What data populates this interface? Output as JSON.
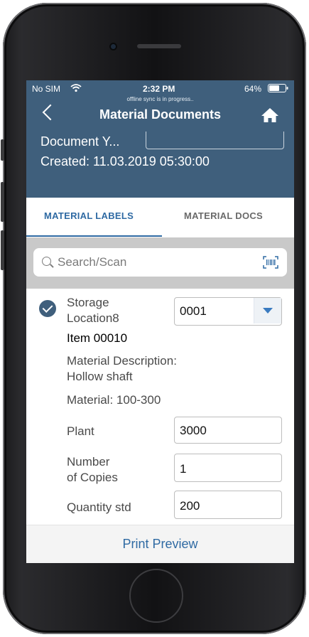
{
  "status_bar": {
    "carrier": "No SIM",
    "time": "2:32 PM",
    "battery": "64%",
    "sync_message": "offline sync is in progress.."
  },
  "header": {
    "title": "Material Documents",
    "document_year_label": "Document Y...",
    "created": "Created: 11.03.2019 05:30:00"
  },
  "tabs": [
    {
      "label": "MATERIAL LABELS",
      "active": true
    },
    {
      "label": "MATERIAL DOCS",
      "active": false
    }
  ],
  "search": {
    "placeholder": "Search/Scan"
  },
  "item": {
    "storage_location_label_1": "Storage",
    "storage_location_label_2": "Location8",
    "storage_location_value": "0001",
    "item_number": "Item 00010",
    "material_description_label": "Material Description:",
    "material_description_value": "Hollow shaft",
    "material": "Material: 100-300",
    "plant_label": "Plant",
    "plant_value": "3000",
    "copies_label_1": "Number",
    "copies_label_2": "of Copies",
    "copies_value": "1",
    "quantity_label": "Quantity std",
    "quantity_value": "200"
  },
  "footer": {
    "print_preview": "Print Preview"
  },
  "colors": {
    "header_bg": "#3f5f7c",
    "accent": "#2f6aa3"
  }
}
